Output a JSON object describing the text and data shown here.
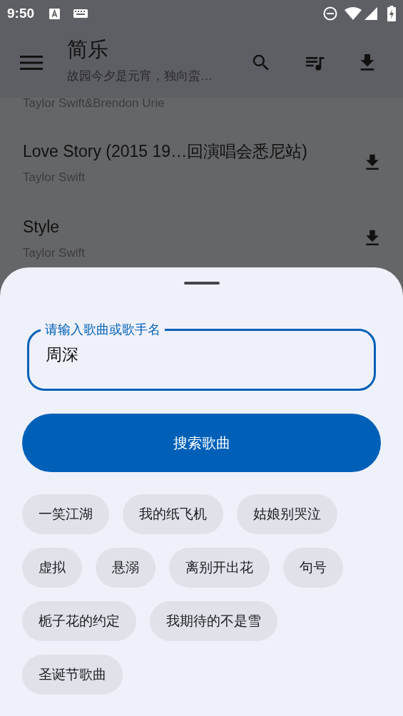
{
  "status_bar": {
    "time": "9:50"
  },
  "app_bar": {
    "title": "简乐",
    "subtitle": "故园今夕是元宵，独向蛮…"
  },
  "songs": [
    {
      "artist": "Taylor Swift&Brendon Urie"
    },
    {
      "title": "Love Story (2015 19…回演唱会悉尼站)",
      "artist": "Taylor Swift"
    },
    {
      "title": "Style",
      "artist": "Taylor Swift"
    }
  ],
  "search_sheet": {
    "field": {
      "label": "请输入歌曲或歌手名",
      "value": "周深"
    },
    "button": "搜索歌曲",
    "suggestions": [
      "一笑江湖",
      "我的纸飞机",
      "姑娘别哭泣",
      "虚拟",
      "悬溺",
      "离别开出花",
      "句号",
      "栀子花的约定",
      "我期待的不是雪",
      "圣诞节歌曲"
    ]
  }
}
